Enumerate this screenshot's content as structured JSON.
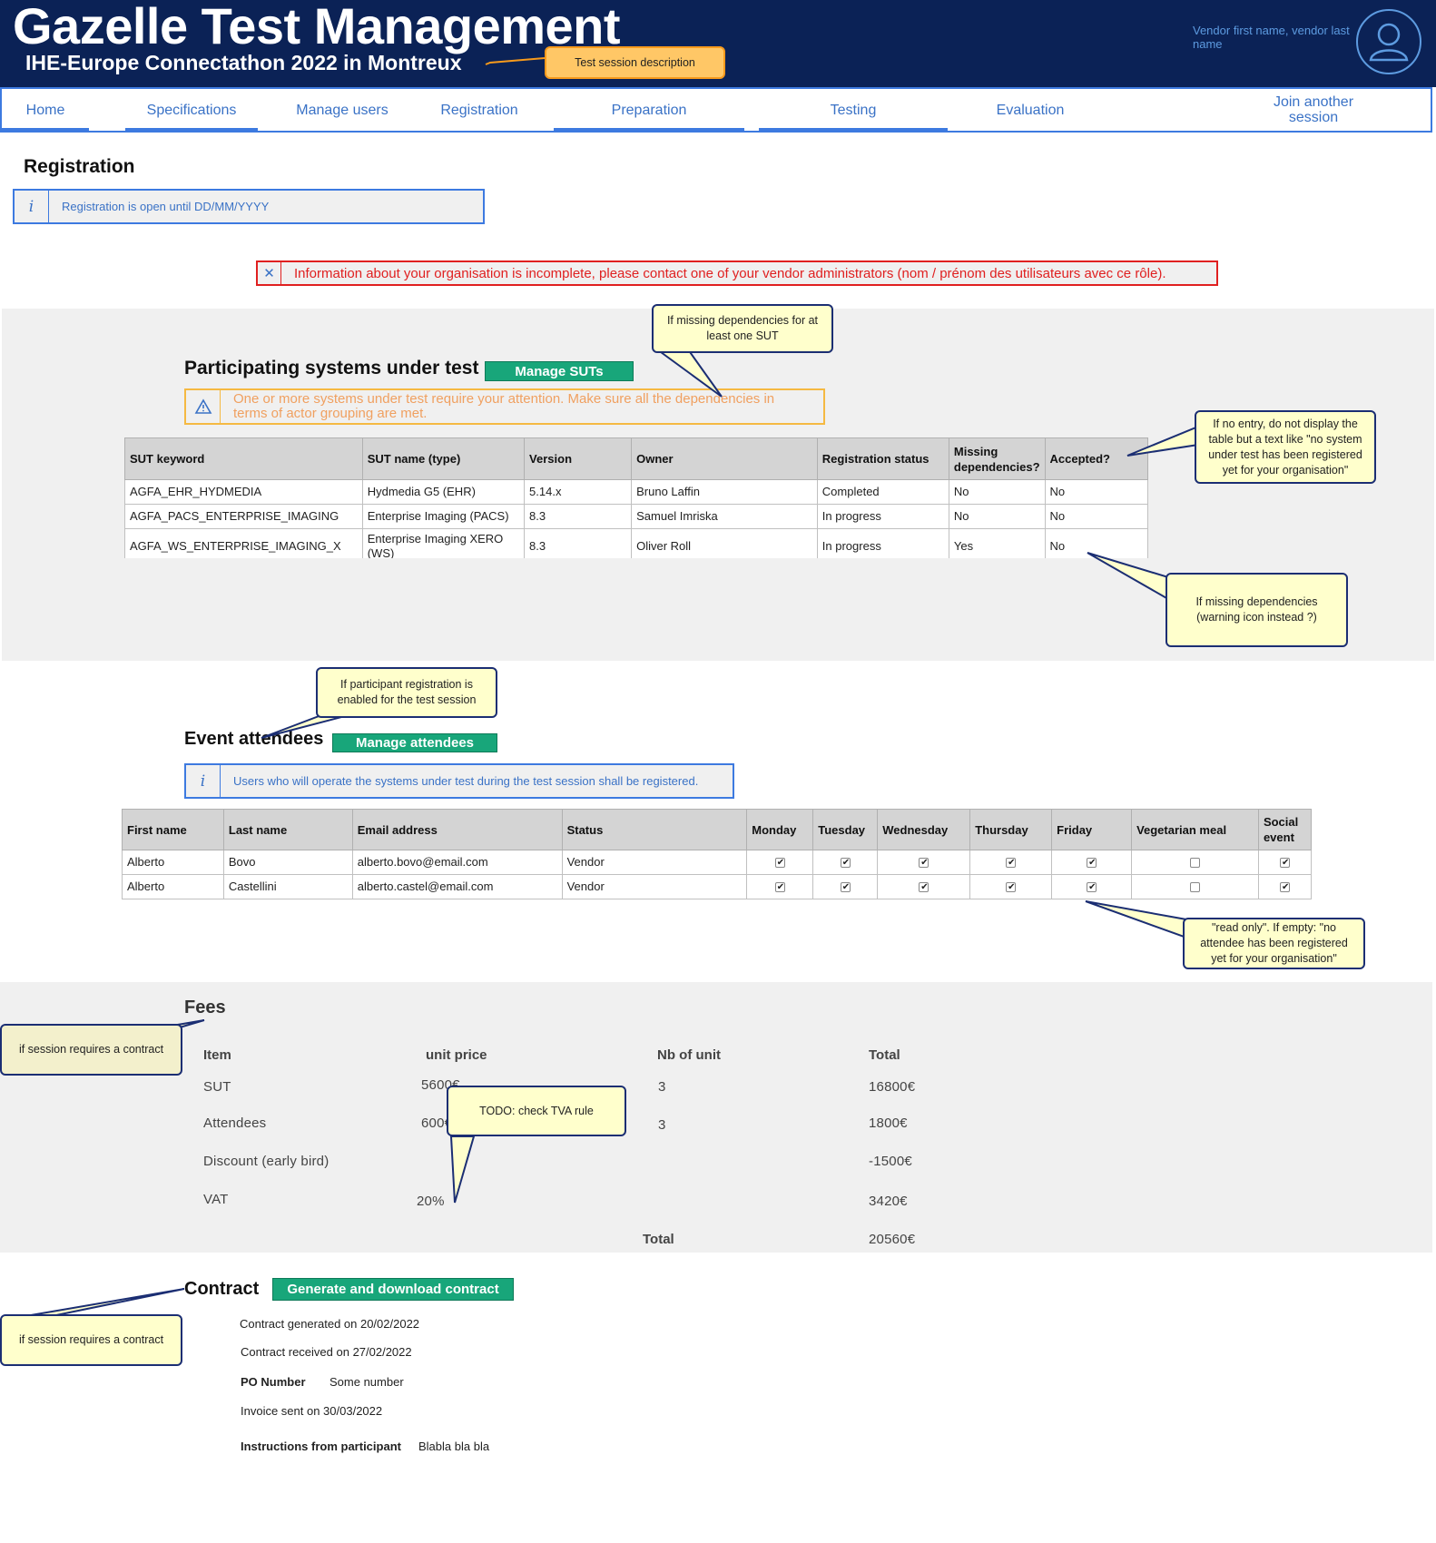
{
  "header": {
    "app_title": "Gazelle Test Management",
    "session_title": "IHE-Europe Connectathon 2022 in Montreux",
    "user_name": "Vendor first name, vendor last name",
    "avatar_icon": "user-icon"
  },
  "nav": {
    "items": [
      {
        "label": "Home"
      },
      {
        "label": "Specifications"
      },
      {
        "label": "Manage users"
      },
      {
        "label": "Registration"
      },
      {
        "label": "Preparation"
      },
      {
        "label": "Testing"
      },
      {
        "label": "Evaluation"
      },
      {
        "label": "Join another session"
      }
    ]
  },
  "page": {
    "title": "Registration",
    "info_text": "Registration is open until DD/MM/YYYY",
    "info_icon": "info-icon",
    "error_text": "Information about your organisation is incomplete, please contact one of your vendor administrators (nom / prénom des utilisateurs avec ce rôle).",
    "error_icon": "close-icon"
  },
  "sut": {
    "title": "Participating systems under test",
    "manage_button": "Manage SUTs",
    "warning_text": "One or more systems under test require your attention. Make sure all the dependencies in terms of actor grouping are met.",
    "warning_icon": "warning-icon",
    "columns": [
      "SUT keyword",
      "SUT name (type)",
      "Version",
      "Owner",
      "Registration status",
      "Missing dependencies?",
      "Accepted?"
    ],
    "rows": [
      [
        "AGFA_EHR_HYDMEDIA",
        "Hydmedia G5 (EHR)",
        "5.14.x",
        "Bruno Laffin",
        "Completed",
        "No",
        "No"
      ],
      [
        "AGFA_PACS_ENTERPRISE_IMAGING",
        "Enterprise Imaging (PACS)",
        "8.3",
        "Samuel Imriska",
        "In progress",
        "No",
        "No"
      ],
      [
        "AGFA_WS_ENTERPRISE_IMAGING_X",
        "Enterprise Imaging XERO (WS)",
        "8.3",
        "Oliver Roll",
        "In progress",
        "Yes",
        "No"
      ]
    ]
  },
  "attendees": {
    "title": "Event attendees",
    "manage_button": "Manage attendees",
    "info_text": "Users who will operate the systems under test during the test session shall be registered.",
    "columns": [
      "First name",
      "Last name",
      "Email address",
      "Status",
      "Monday",
      "Tuesday",
      "Wednesday",
      "Thursday",
      "Friday",
      "Vegetarian meal",
      "Social event"
    ],
    "rows": [
      {
        "first": "Alberto",
        "last": "Bovo",
        "email": "alberto.bovo@email.com",
        "status": "Vendor",
        "checks": [
          true,
          true,
          true,
          true,
          true,
          false,
          true
        ]
      },
      {
        "first": "Alberto",
        "last": "Castellini",
        "email": "alberto.castel@email.com",
        "status": "Vendor",
        "checks": [
          true,
          true,
          true,
          true,
          true,
          false,
          true
        ]
      }
    ]
  },
  "fees": {
    "title": "Fees",
    "headers": {
      "item": "Item",
      "unit_price": "unit price",
      "nb": "Nb of unit",
      "total": "Total"
    },
    "rows": [
      {
        "item": "SUT",
        "unit_price": "5600€",
        "nb": "3",
        "total": "16800€"
      },
      {
        "item": "Attendees",
        "unit_price": "600€",
        "nb": "3",
        "total": "1800€"
      },
      {
        "item": "Discount (early bird)",
        "unit_price": "",
        "nb": "",
        "total": "-1500€"
      },
      {
        "item": "VAT",
        "unit_price": "20%",
        "nb": "",
        "total": "3420€"
      }
    ],
    "grand_total_label": "Total",
    "grand_total": "20560€"
  },
  "contract": {
    "title": "Contract",
    "button": "Generate and download contract",
    "generated": "Contract generated on 20/02/2022",
    "received": "Contract received on 27/02/2022",
    "po_label": "PO Number",
    "po_value": "Some number",
    "invoice": "Invoice sent on 30/03/2022",
    "instructions_label": "Instructions from participant",
    "instructions_value": "Blabla bla bla"
  },
  "callouts": {
    "session_desc": "Test session description",
    "missing_deps_sut": "If missing dependencies for at least one SUT",
    "no_entry": "If no entry, do not display the table but a text like \"no system under test has been registered yet for your organisation\"",
    "missing_deps_icon": "If missing dependencies (warning icon instead ?)",
    "participant_reg": "If participant registration is enabled for the test session",
    "read_only": "\"read only\". If empty: \"no attendee has been registered yet for your organisation\"",
    "fees_contract": "if session requires a contract",
    "tva": "TODO: check TVA rule",
    "contract_contract": "if session requires a contract"
  },
  "colors": {
    "header_bg": "#0b2256",
    "nav_accent": "#3d7ae0",
    "button_green": "#18a67a",
    "error_red": "#e02020",
    "warning_orange": "#f5b942",
    "callout_yellow": "#ffffcc"
  }
}
